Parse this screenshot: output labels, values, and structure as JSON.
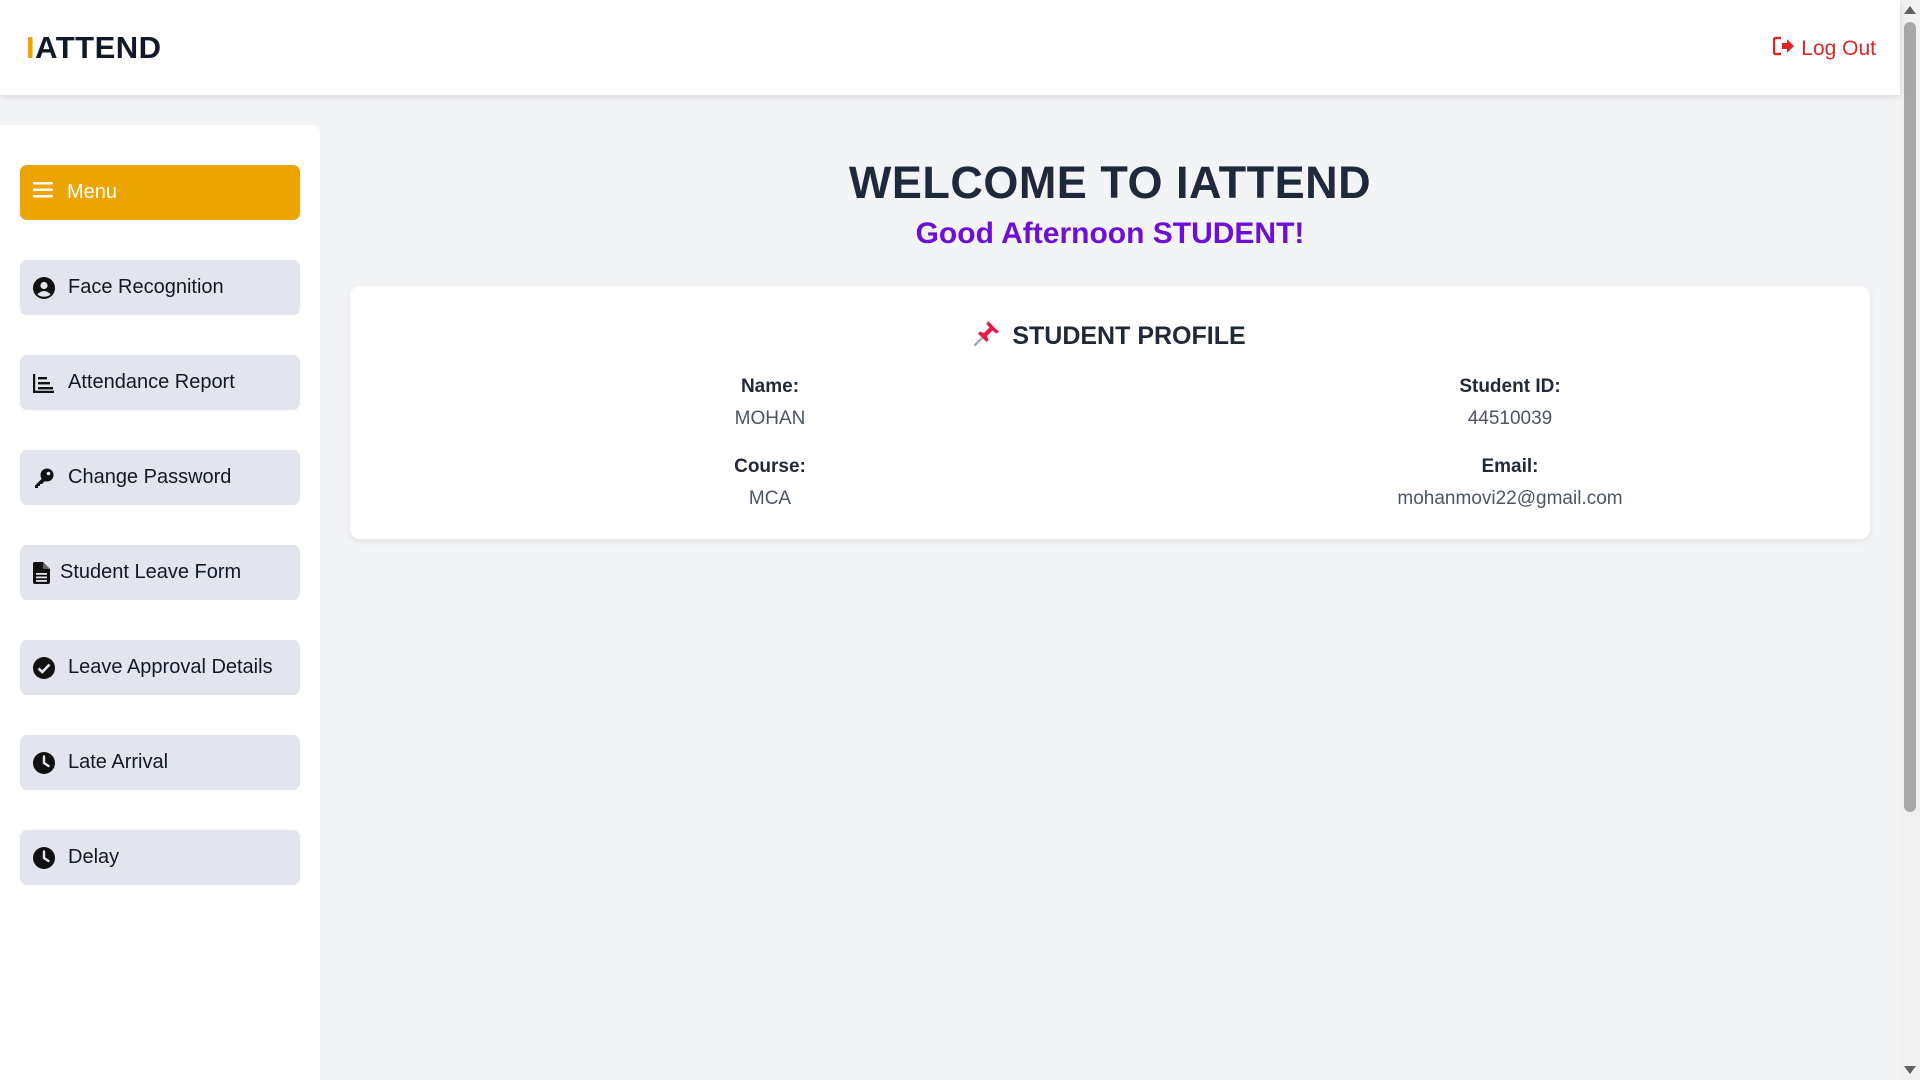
{
  "header": {
    "logo_accent": "I",
    "logo_rest": "ATTEND",
    "logout_label": "Log Out"
  },
  "sidebar": {
    "menu_label": "Menu",
    "items": [
      {
        "label": "Face Recognition",
        "icon": "user-circle-icon"
      },
      {
        "label": "Attendance Report",
        "icon": "chart-icon"
      },
      {
        "label": "Change Password",
        "icon": "key-icon"
      },
      {
        "label": "Student Leave Form",
        "icon": "document-icon"
      },
      {
        "label": "Leave Approval Details",
        "icon": "check-circle-icon"
      },
      {
        "label": "Late Arrival",
        "icon": "clock-icon"
      },
      {
        "label": "Delay",
        "icon": "clock-icon"
      }
    ]
  },
  "main": {
    "welcome": "WELCOME TO IATTEND",
    "greeting": "Good Afternoon STUDENT!",
    "profile": {
      "title": "STUDENT PROFILE",
      "name_label": "Name:",
      "name_value": "MOHAN",
      "id_label": "Student ID:",
      "id_value": "44510039",
      "course_label": "Course:",
      "course_value": "MCA",
      "email_label": "Email:",
      "email_value": "mohanmovi22@gmail.com"
    }
  },
  "colors": {
    "accent": "#eca400",
    "logout": "#dc2626",
    "greeting": "#6d0fd6"
  }
}
